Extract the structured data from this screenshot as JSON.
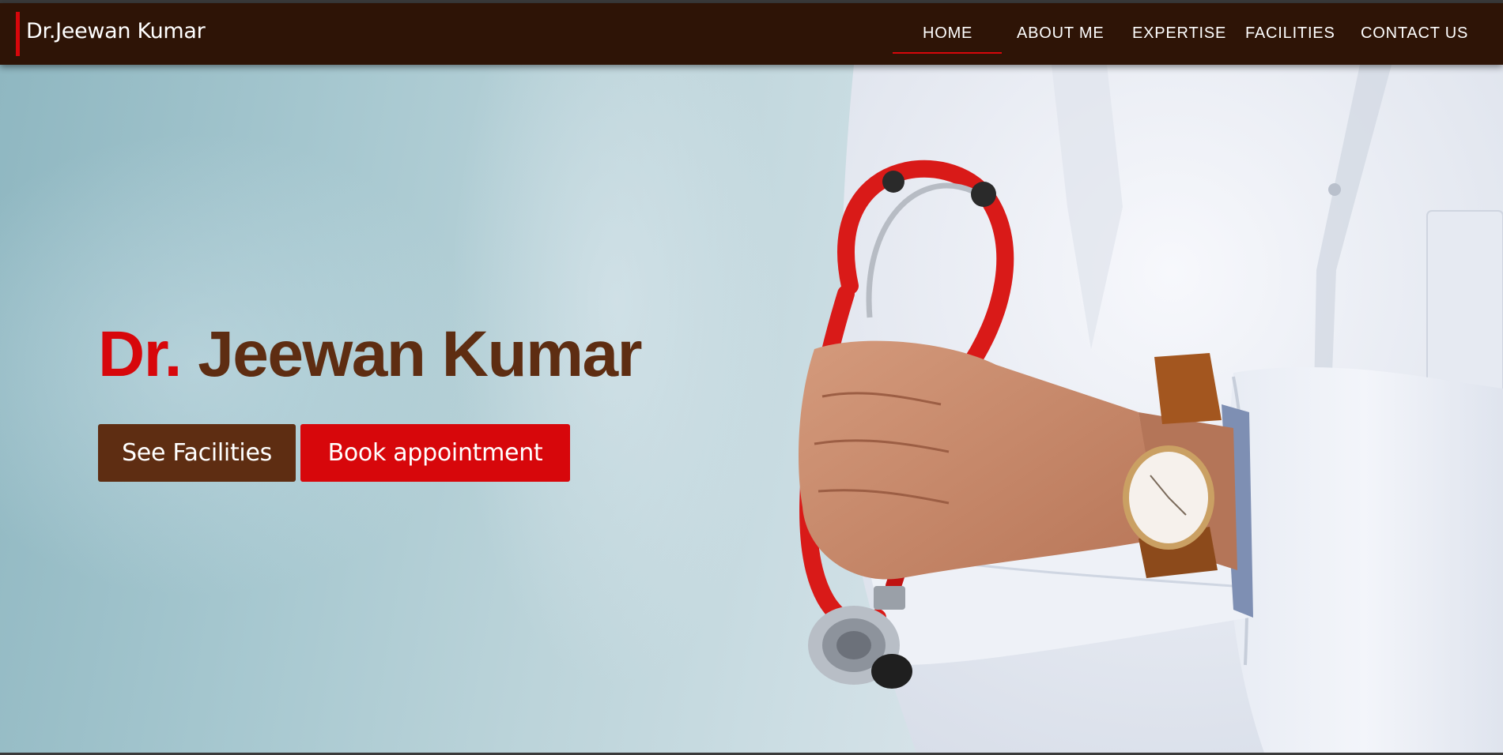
{
  "header": {
    "brand": "Dr.Jeewan Kumar",
    "nav": [
      {
        "label": "HOME",
        "active": true
      },
      {
        "label": "ABOUT ME"
      },
      {
        "label": "EXPERTISE"
      },
      {
        "label": "FACILITIES"
      },
      {
        "label": "CONTACT US"
      }
    ]
  },
  "hero": {
    "title_prefix": "Dr.",
    "title_name": "Jeewan Kumar",
    "buttons": {
      "facilities": "See Facilities",
      "book": "Book appointment"
    },
    "image": "doctor-with-stethoscope-photo"
  },
  "colors": {
    "navbar": "#2e1406",
    "accent_red": "#d7070b",
    "brown": "#5e2d12",
    "white": "#ffffff"
  }
}
